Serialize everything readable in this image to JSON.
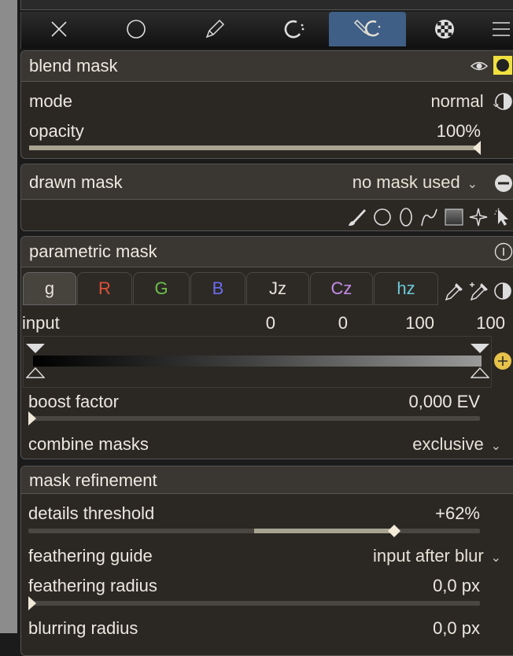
{
  "toolbar": {
    "tabs": [
      {
        "icon": "close-icon"
      },
      {
        "icon": "circle-icon"
      },
      {
        "icon": "pencil-icon"
      },
      {
        "icon": "raster-icon"
      },
      {
        "icon": "drawn-parametric-icon",
        "active": true
      },
      {
        "icon": "checkerboard-icon"
      },
      {
        "icon": "menu-icon"
      }
    ]
  },
  "blend_mask": {
    "title": "blend mask",
    "mode_label": "mode",
    "mode_value": "normal",
    "opacity_label": "opacity",
    "opacity_value": "100%",
    "opacity_fraction": 1.0
  },
  "drawn_mask": {
    "title": "drawn mask",
    "value": "no mask used",
    "shape_tools": [
      "brush-icon",
      "circle-shape-icon",
      "ellipse-shape-icon",
      "path-shape-icon",
      "gradient-shape-icon",
      "star-shape-icon",
      "pointer-icon"
    ]
  },
  "parametric_mask": {
    "title": "parametric mask",
    "channels": [
      {
        "label": "g",
        "color": "#e6e2d6",
        "active": true
      },
      {
        "label": "R",
        "color": "#e0503a"
      },
      {
        "label": "G",
        "color": "#6cc24a"
      },
      {
        "label": "B",
        "color": "#6b6cf0"
      },
      {
        "label": "Jz",
        "color": "#e6e2d6"
      },
      {
        "label": "Cz",
        "color": "#c78ce8"
      },
      {
        "label": "hz",
        "color": "#6cc8d8"
      }
    ],
    "input_label": "input",
    "input_values": [
      "0",
      "0",
      "100",
      "100"
    ],
    "boost_label": "boost factor",
    "boost_value": "0,000 EV",
    "combine_label": "combine masks",
    "combine_value": "exclusive"
  },
  "mask_refinement": {
    "title": "mask refinement",
    "details_label": "details threshold",
    "details_value": "+62%",
    "details_fraction": 0.62,
    "feather_guide_label": "feathering guide",
    "feather_guide_value": "input after blur",
    "feather_radius_label": "feathering radius",
    "feather_radius_value": "0,0 px",
    "blur_label": "blurring radius",
    "blur_value": "0,0 px"
  },
  "colors": {
    "accent_active_tab": "#3f5f86",
    "highlight_yellow": "#f0e040",
    "plus_button": "#e6c24a"
  }
}
